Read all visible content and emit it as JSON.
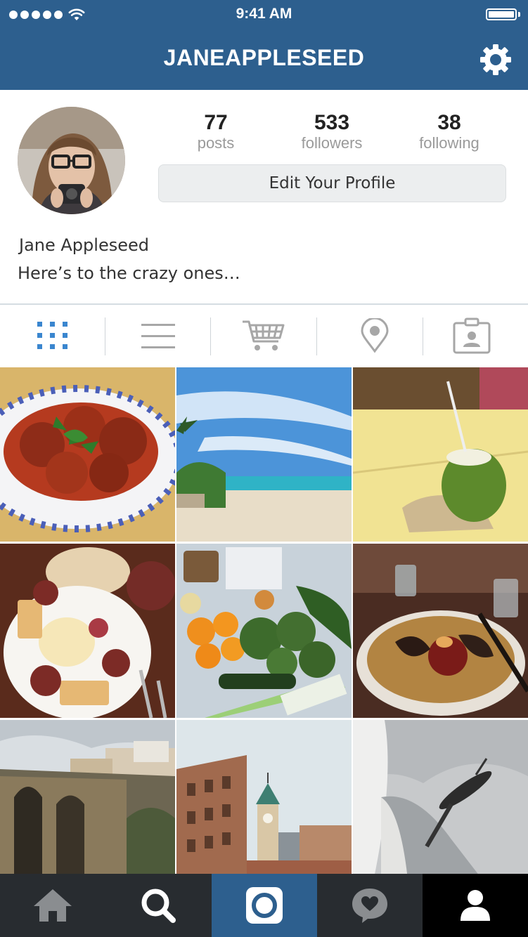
{
  "status_bar": {
    "time": "9:41 AM"
  },
  "header": {
    "username": "JANEAPPLESEED",
    "settings_icon": "gear-icon"
  },
  "profile": {
    "full_name": "Jane Appleseed",
    "bio": "Here’s to the crazy ones…",
    "stats": [
      {
        "value": "77",
        "label": "posts"
      },
      {
        "value": "533",
        "label": "followers"
      },
      {
        "value": "38",
        "label": "following"
      }
    ],
    "edit_button_label": "Edit Your Profile"
  },
  "tabs": [
    {
      "icon": "grid-icon",
      "active": true
    },
    {
      "icon": "list-icon",
      "active": false
    },
    {
      "icon": "cart-icon",
      "active": false
    },
    {
      "icon": "location-pin-icon",
      "active": false
    },
    {
      "icon": "tagged-user-icon",
      "active": false
    }
  ],
  "photos": [
    "chicken-wings-plate",
    "tropical-beach",
    "coconut-drink",
    "breakfast-plate",
    "groceries-vegetables",
    "ramen-bowl",
    "bridge-over-gorge",
    "city-clock-tower",
    "space-needle"
  ],
  "bottom_nav": [
    {
      "icon": "home-icon",
      "active": false
    },
    {
      "icon": "search-icon",
      "active": false
    },
    {
      "icon": "camera-icon",
      "active": true
    },
    {
      "icon": "activity-heart-icon",
      "active": false
    },
    {
      "icon": "profile-icon",
      "active": true
    }
  ],
  "colors": {
    "header_bg": "#2d5f8e",
    "nav_bg": "#282c30",
    "nav_active_camera": "#2d5f8e",
    "nav_active_profile": "#000000",
    "tab_active": "#3a86cf",
    "tab_inactive": "#a7a7a7"
  }
}
